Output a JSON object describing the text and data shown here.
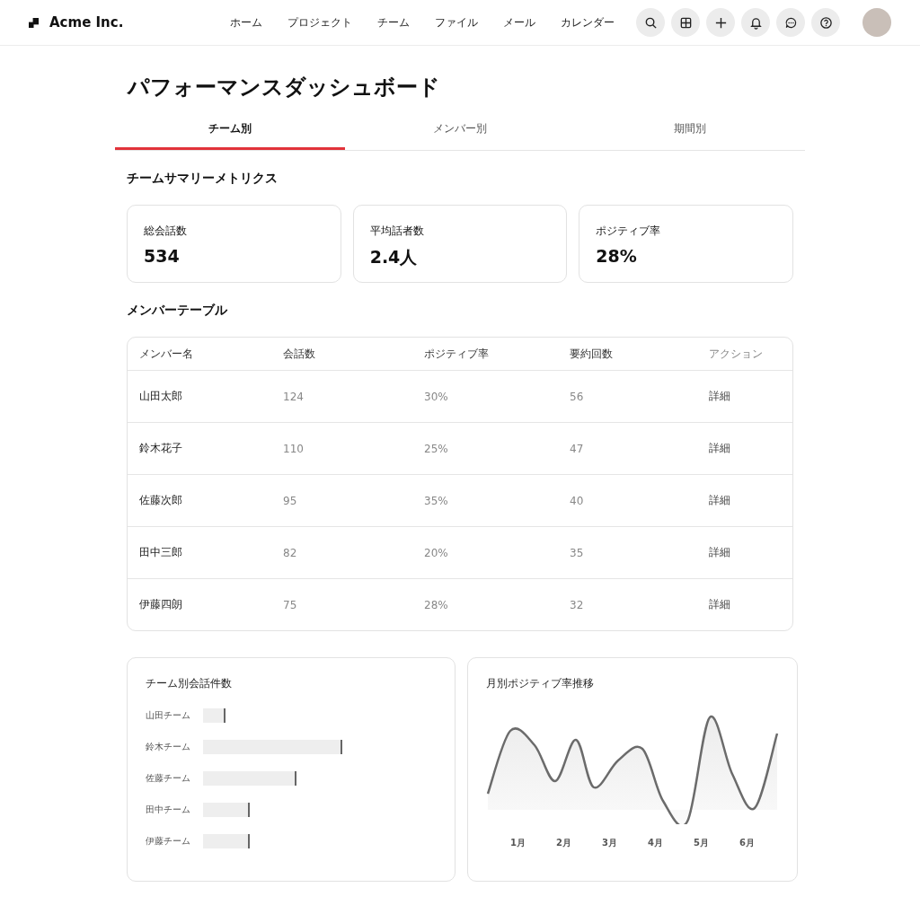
{
  "header": {
    "brand": "Acme Inc.",
    "nav": [
      "ホーム",
      "プロジェクト",
      "チーム",
      "ファイル",
      "メール",
      "カレンダー"
    ],
    "icon_buttons": [
      {
        "kind": "search"
      },
      {
        "kind": "grid"
      },
      {
        "kind": "plus"
      },
      {
        "kind": "bell"
      },
      {
        "kind": "chat"
      },
      {
        "kind": "help"
      }
    ]
  },
  "page": {
    "title": "パフォーマンスダッシュボード"
  },
  "tabs": [
    {
      "label": "チーム別",
      "selected": true
    },
    {
      "label": "メンバー別",
      "selected": false
    },
    {
      "label": "期間別",
      "selected": false
    }
  ],
  "summary": {
    "title": "チームサマリーメトリクス",
    "metrics": [
      {
        "label": "総会話数",
        "value": "534"
      },
      {
        "label": "平均話者数",
        "value": "2.4人"
      },
      {
        "label": "ポジティブ率",
        "value": "28%"
      }
    ]
  },
  "member_table": {
    "title": "メンバーテーブル",
    "columns": [
      "メンバー名",
      "会話数",
      "ポジティブ率",
      "要約回数",
      "アクション"
    ],
    "rows": [
      {
        "cells": [
          "山田太郎",
          "124",
          "30%",
          "56"
        ],
        "action": "詳細"
      },
      {
        "cells": [
          "鈴木花子",
          "110",
          "25%",
          "47"
        ],
        "action": "詳細"
      },
      {
        "cells": [
          "佐藤次郎",
          "95",
          "35%",
          "40"
        ],
        "action": "詳細"
      },
      {
        "cells": [
          "田中三郎",
          "82",
          "20%",
          "35"
        ],
        "action": "詳細"
      },
      {
        "cells": [
          "伊藤四朗",
          "75",
          "28%",
          "32"
        ],
        "action": "詳細"
      }
    ]
  },
  "team_chart": {
    "title": "チーム別会話件数",
    "bars": [
      {
        "label": "山田チーム"
      },
      {
        "label": "鈴木チーム"
      },
      {
        "label": "佐藤チーム"
      },
      {
        "label": "田中チーム"
      },
      {
        "label": "伊藤チーム"
      }
    ]
  },
  "trend_chart": {
    "title": "月別ポジティブ率推移",
    "months": [
      "1月",
      "2月",
      "3月",
      "4月",
      "5月",
      "6月"
    ]
  }
}
